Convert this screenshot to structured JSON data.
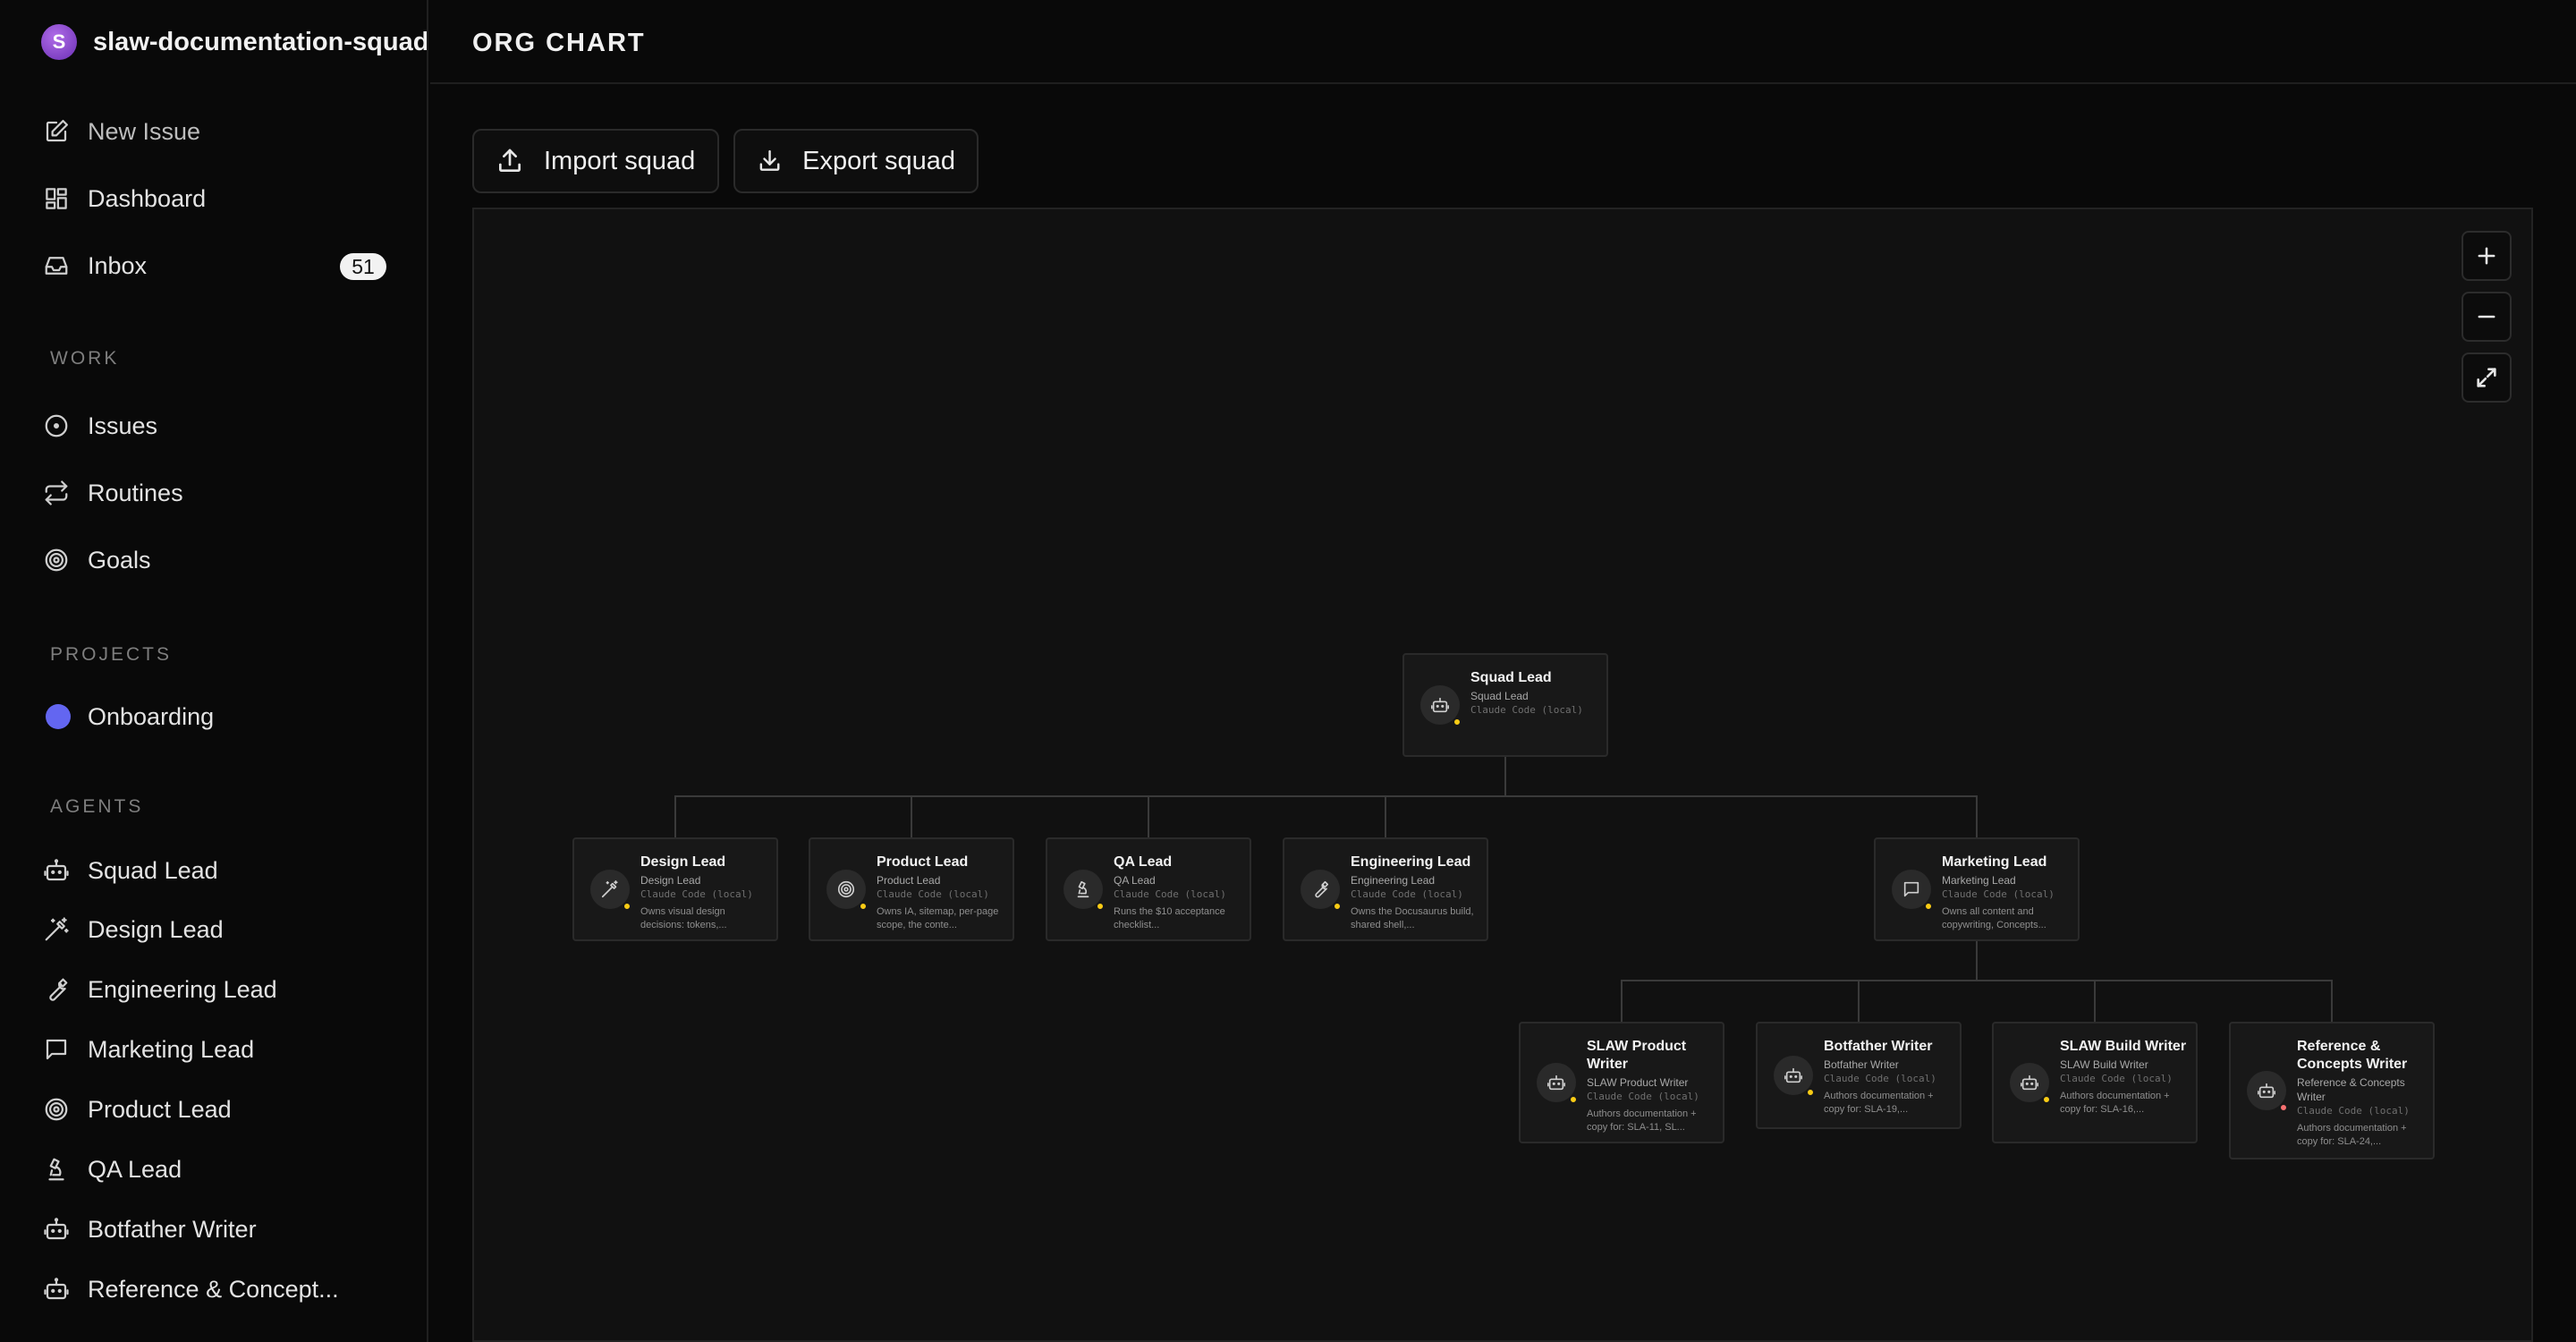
{
  "sidebar": {
    "brand_initial": "S",
    "brand_name": "slaw-documentation-squad",
    "top_items": [
      {
        "label": "New Issue",
        "icon": "edit-icon"
      },
      {
        "label": "Dashboard",
        "icon": "dashboard-icon"
      },
      {
        "label": "Inbox",
        "icon": "inbox-icon",
        "badge": "51"
      }
    ],
    "work_title": "WORK",
    "work_items": [
      {
        "label": "Issues",
        "icon": "issue-circle-icon"
      },
      {
        "label": "Routines",
        "icon": "repeat-icon"
      },
      {
        "label": "Goals",
        "icon": "target-icon"
      }
    ],
    "projects_title": "PROJECTS",
    "projects": [
      {
        "label": "Onboarding",
        "color": "#6366f1"
      }
    ],
    "agents_title": "AGENTS",
    "agents": [
      {
        "label": "Squad Lead",
        "icon": "bot-icon"
      },
      {
        "label": "Design Lead",
        "icon": "wand-icon"
      },
      {
        "label": "Engineering Lead",
        "icon": "wrench-icon"
      },
      {
        "label": "Marketing Lead",
        "icon": "message-icon"
      },
      {
        "label": "Product Lead",
        "icon": "target-icon"
      },
      {
        "label": "QA Lead",
        "icon": "microscope-icon"
      },
      {
        "label": "Botfather Writer",
        "icon": "bot-icon"
      },
      {
        "label": "Reference & Concept...",
        "icon": "bot-icon"
      }
    ]
  },
  "header": {
    "title": "ORG CHART"
  },
  "toolbar": {
    "import_label": "Import squad",
    "export_label": "Export squad"
  },
  "org": {
    "squad_lead": {
      "name": "Squad Lead",
      "role": "Squad Lead",
      "adapter": "Claude Code (local)",
      "desc": "",
      "icon": "bot-icon",
      "status": "#facc15"
    },
    "design_lead": {
      "name": "Design Lead",
      "role": "Design Lead",
      "adapter": "Claude Code (local)",
      "desc": "Owns visual design decisions: tokens,...",
      "icon": "wand-icon",
      "status": "#facc15"
    },
    "product_lead": {
      "name": "Product Lead",
      "role": "Product Lead",
      "adapter": "Claude Code (local)",
      "desc": "Owns IA, sitemap, per-page scope, the conte...",
      "icon": "target-icon",
      "status": "#facc15"
    },
    "qa_lead": {
      "name": "QA Lead",
      "role": "QA Lead",
      "adapter": "Claude Code (local)",
      "desc": "Runs the $10 acceptance checklist...",
      "icon": "microscope-icon",
      "status": "#facc15"
    },
    "engineering_lead": {
      "name": "Engineering Lead",
      "role": "Engineering Lead",
      "adapter": "Claude Code (local)",
      "desc": "Owns the Docusaurus build, shared shell,...",
      "icon": "wrench-icon",
      "status": "#facc15"
    },
    "marketing_lead": {
      "name": "Marketing Lead",
      "role": "Marketing Lead",
      "adapter": "Claude Code (local)",
      "desc": "Owns all content and copywriting, Concepts...",
      "icon": "message-icon",
      "status": "#facc15"
    },
    "slaw_product_writer": {
      "name": "SLAW Product Writer",
      "role": "SLAW Product Writer",
      "adapter": "Claude Code (local)",
      "desc": "Authors documentation + copy for: SLA-11, SL...",
      "icon": "bot-icon",
      "status": "#facc15"
    },
    "botfather_writer": {
      "name": "Botfather Writer",
      "role": "Botfather Writer",
      "adapter": "Claude Code (local)",
      "desc": "Authors documentation + copy for: SLA-19,...",
      "icon": "bot-icon",
      "status": "#facc15"
    },
    "slaw_build_writer": {
      "name": "SLAW Build Writer",
      "role": "SLAW Build Writer",
      "adapter": "Claude Code (local)",
      "desc": "Authors documentation + copy for: SLA-16,...",
      "icon": "bot-icon",
      "status": "#facc15"
    },
    "reference_writer": {
      "name": "Reference & Concepts Writer",
      "role": "Reference & Concepts Writer",
      "adapter": "Claude Code (local)",
      "desc": "Authors documentation + copy for: SLA-24,...",
      "icon": "bot-icon",
      "status": "#f87171"
    }
  }
}
